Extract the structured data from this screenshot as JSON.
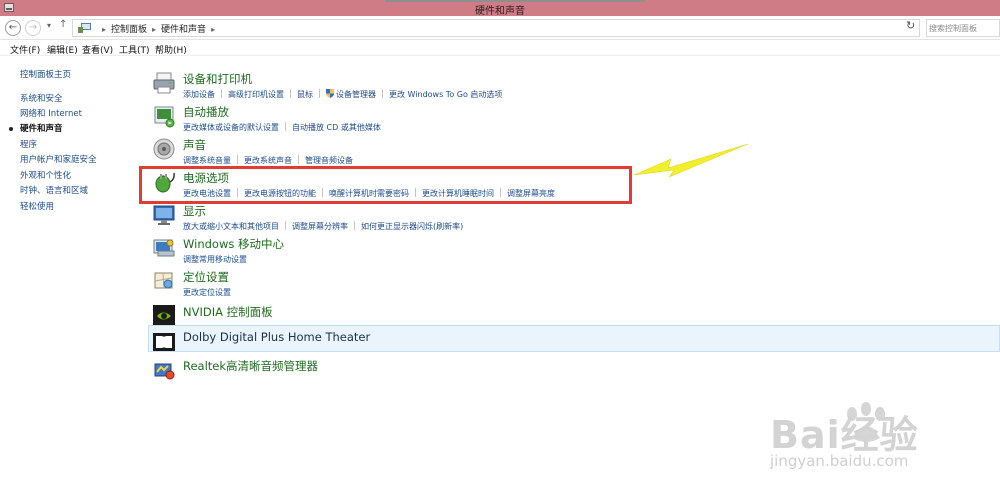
{
  "window": {
    "title": "硬件和声音"
  },
  "address_bar": {
    "breadcrumbs": [
      "控制面板",
      "硬件和声音"
    ],
    "search_placeholder": "搜索控制面板"
  },
  "menu": {
    "items": [
      "文件(F)",
      "编辑(E)",
      "查看(V)",
      "工具(T)",
      "帮助(H)"
    ]
  },
  "left_nav": {
    "home": "控制面板主页",
    "items": [
      {
        "label": "系统和安全"
      },
      {
        "label": "网络和 Internet"
      },
      {
        "label": "硬件和声音",
        "current": true
      },
      {
        "label": "程序"
      },
      {
        "label": "用户帐户和家庭安全"
      },
      {
        "label": "外观和个性化"
      },
      {
        "label": "时钟、语言和区域"
      },
      {
        "label": "轻松使用"
      }
    ]
  },
  "categories": [
    {
      "title": "设备和打印机",
      "links": [
        "添加设备",
        "高级打印机设置",
        "鼠标",
        "设备管理器",
        "更改 Windows To Go 启动选项"
      ],
      "icon": "printer-icon"
    },
    {
      "title": "自动播放",
      "links": [
        "更改媒体或设备的默认设置",
        "自动播放 CD 或其他媒体"
      ],
      "icon": "autoplay-icon"
    },
    {
      "title": "声音",
      "links": [
        "调整系统音量",
        "更改系统声音",
        "管理音频设备"
      ],
      "icon": "speaker-icon"
    },
    {
      "title": "电源选项",
      "links": [
        "更改电池设置",
        "更改电源按钮的功能",
        "唤醒计算机时需要密码",
        "更改计算机睡眠时间",
        "调整屏幕亮度"
      ],
      "icon": "power-plug-icon"
    },
    {
      "title": "显示",
      "links": [
        "放大或缩小文本和其他项目",
        "调整屏幕分辨率",
        "如何更正显示器闪烁(刷新率)"
      ],
      "icon": "display-icon"
    },
    {
      "title": "Windows 移动中心",
      "links": [
        "调整常用移动设置"
      ],
      "icon": "mobility-center-icon"
    },
    {
      "title": "定位设置",
      "links": [
        "更改定位设置"
      ],
      "icon": "location-icon"
    },
    {
      "title": "NVIDIA 控制面板",
      "links": [],
      "icon": "nvidia-icon"
    },
    {
      "title": "Dolby Digital Plus Home Theater",
      "links": [],
      "icon": "dolby-icon"
    },
    {
      "title": "Realtek高清晰音频管理器",
      "links": [],
      "icon": "realtek-icon"
    }
  ],
  "watermark": {
    "brand": "Bai经验",
    "url": "jingyan.baidu.com"
  },
  "colors": {
    "title_bar": "#cf7c86",
    "category_title": "#1e6a1e",
    "link": "#1c4b8a",
    "highlight_box": "#e23b35",
    "arrow": "#f1ee2a",
    "dolby_hover": "#eaf4fd"
  }
}
